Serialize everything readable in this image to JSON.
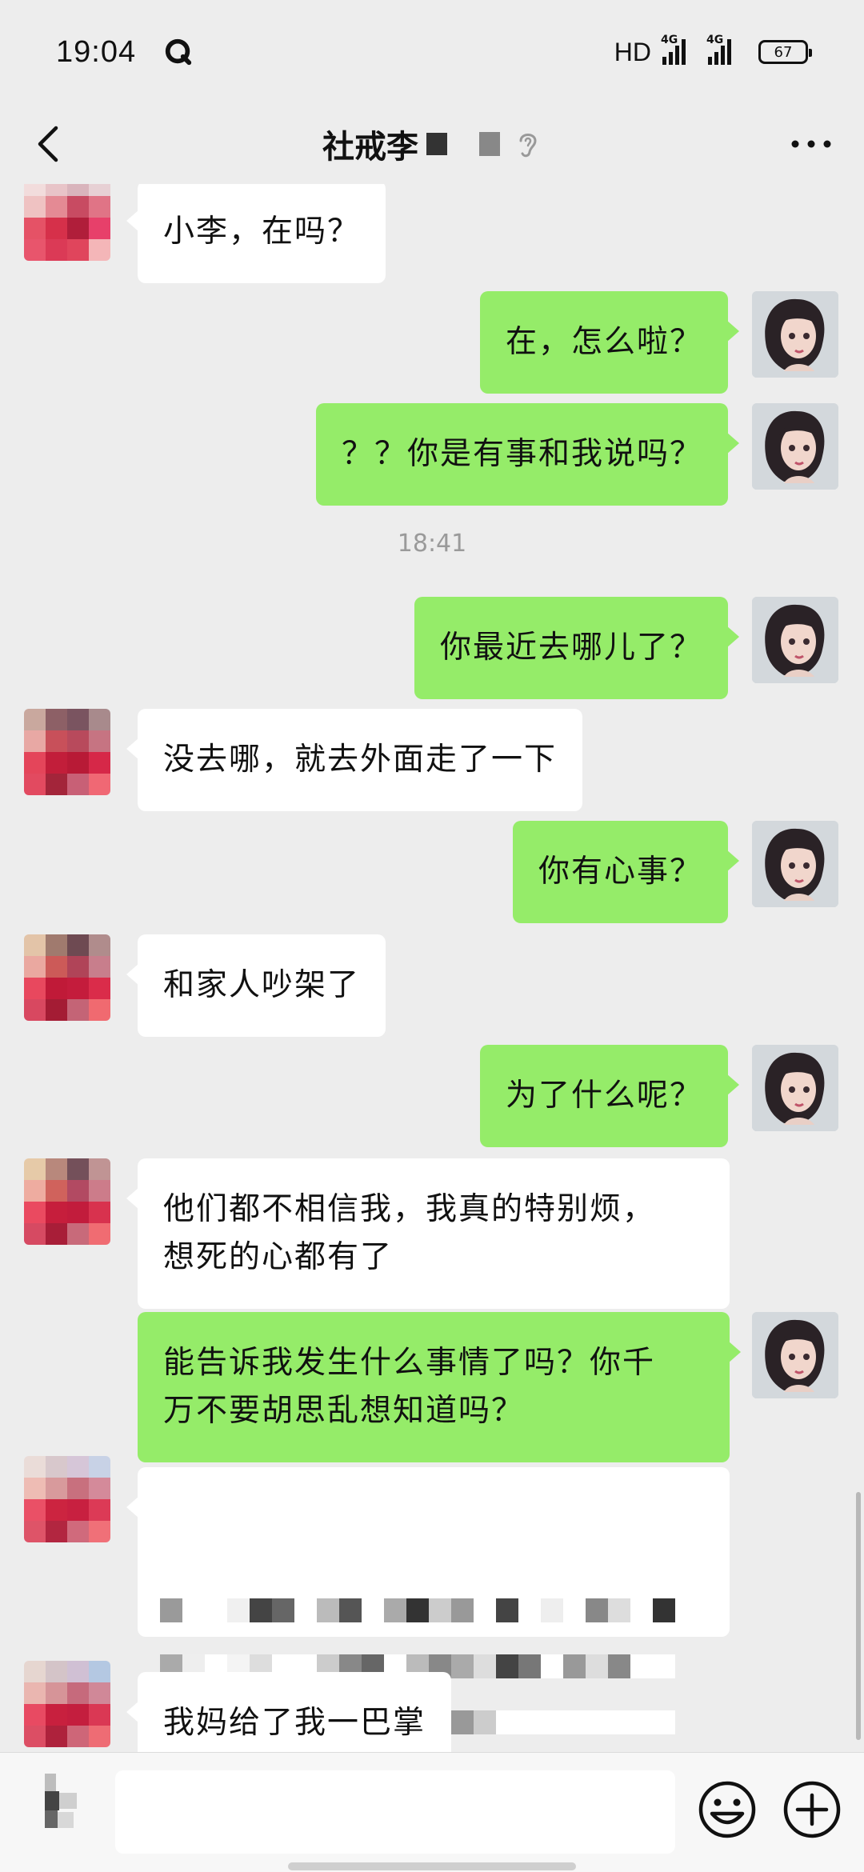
{
  "status_bar": {
    "time": "19:04",
    "hd_label": "HD",
    "network_1": "4G",
    "network_2": "4G",
    "battery": "67",
    "icons": [
      "app-q-icon",
      "signal-icon",
      "battery-icon"
    ]
  },
  "nav": {
    "title": "社戒李",
    "icons": [
      "back-icon",
      "ear-icon",
      "more-icon"
    ]
  },
  "messages": [
    {
      "side": "in",
      "text": "小李，在吗？"
    },
    {
      "side": "out",
      "text": "在，怎么啦？"
    },
    {
      "side": "out",
      "text": "？？你是有事和我说吗？"
    },
    {
      "side": "out",
      "text": "你最近去哪儿了？"
    },
    {
      "side": "in",
      "text": "没去哪，就去外面走了一下"
    },
    {
      "side": "out",
      "text": "你有心事？"
    },
    {
      "side": "in",
      "text": "和家人吵架了"
    },
    {
      "side": "out",
      "text": "为了什么呢？"
    },
    {
      "side": "in",
      "text": "他们都不相信我，我真的特别烦，\n想死的心都有了"
    },
    {
      "side": "out",
      "text": "能告诉我发生什么事情了吗？你千\n万不要胡思乱想知道吗？"
    },
    {
      "side": "in",
      "text": "",
      "mosaic": true
    },
    {
      "side": "in",
      "text": "我妈给了我一巴掌"
    }
  ],
  "timestamp": "18:41",
  "input_bar": {
    "placeholder": "",
    "icons": [
      "voice-icon",
      "emoji-icon",
      "plus-icon"
    ]
  },
  "colors": {
    "background": "#ededed",
    "bubble_out": "#95ec69",
    "bubble_in": "#ffffff",
    "timestamp": "#9a9a9a"
  }
}
